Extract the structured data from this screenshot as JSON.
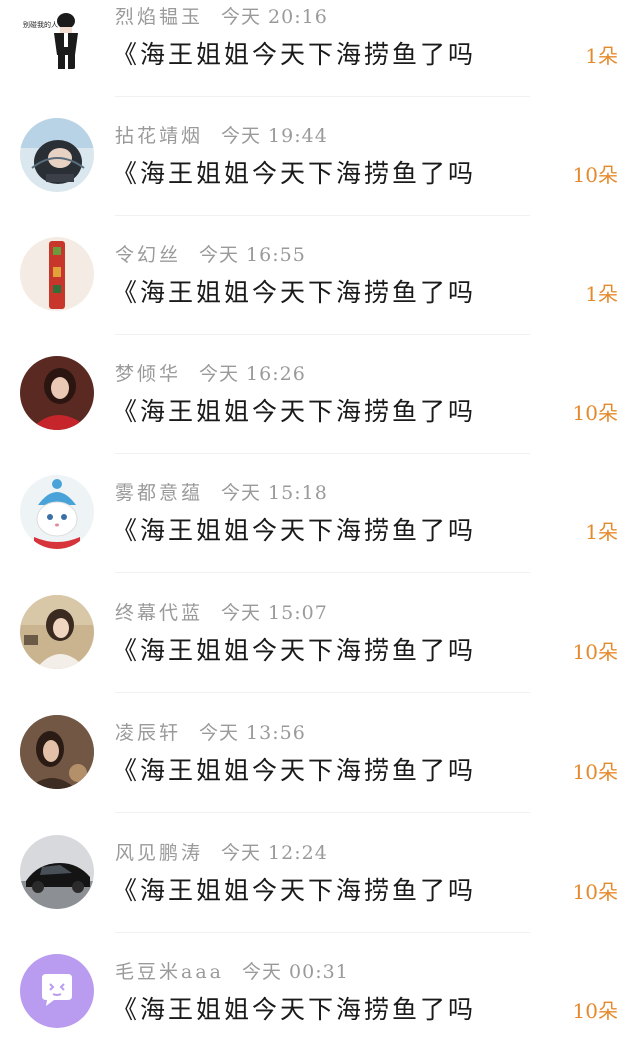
{
  "colors": {
    "username": "#9a9a9a",
    "message": "#1a1a1a",
    "flowers": "#e58a2c",
    "divider": "#f1f1f1"
  },
  "items": [
    {
      "username": "烈焰韫玉",
      "time": "今天 20:16",
      "message": "《海王姐姐今天下海捞鱼了吗",
      "flowers": "1朵",
      "avatar": "anime-boy-avatar",
      "avatar_text": "别碰我的人"
    },
    {
      "username": "拈花靖烟",
      "time": "今天 19:44",
      "message": "《海王姐姐今天下海捞鱼了吗",
      "flowers": "10朵",
      "avatar": "girl-photo-avatar"
    },
    {
      "username": "令幻丝",
      "time": "今天 16:55",
      "message": "《海王姐姐今天下海捞鱼了吗",
      "flowers": "1朵",
      "avatar": "red-pillar-avatar"
    },
    {
      "username": "梦倾华",
      "time": "今天 16:26",
      "message": "《海王姐姐今天下海捞鱼了吗",
      "flowers": "10朵",
      "avatar": "woman-red-avatar"
    },
    {
      "username": "雾都意蕴",
      "time": "今天 15:18",
      "message": "《海王姐姐今天下海捞鱼了吗",
      "flowers": "1朵",
      "avatar": "cat-hat-avatar"
    },
    {
      "username": "终幕代蓝",
      "time": "今天 15:07",
      "message": "《海王姐姐今天下海捞鱼了吗",
      "flowers": "10朵",
      "avatar": "girl-scarf-avatar"
    },
    {
      "username": "凌辰轩",
      "time": "今天 13:56",
      "message": "《海王姐姐今天下海捞鱼了吗",
      "flowers": "10朵",
      "avatar": "girl-dark-avatar"
    },
    {
      "username": "风见鹏涛",
      "time": "今天 12:24",
      "message": "《海王姐姐今天下海捞鱼了吗",
      "flowers": "10朵",
      "avatar": "black-car-avatar"
    },
    {
      "username": "毛豆米aaa",
      "time": "今天 00:31",
      "message": "《海王姐姐今天下海捞鱼了吗",
      "flowers": "10朵",
      "avatar": "default-chat-avatar"
    }
  ]
}
